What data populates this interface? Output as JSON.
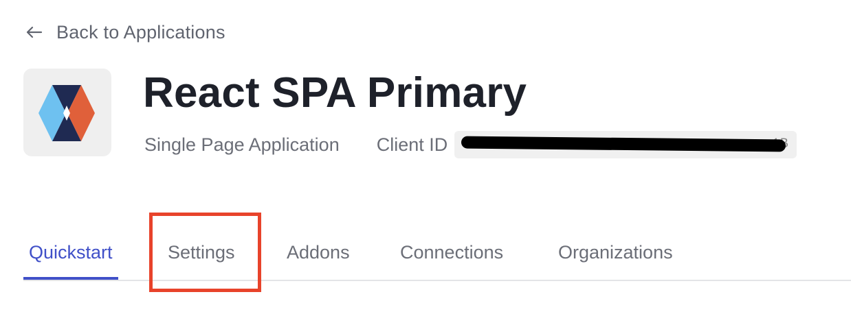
{
  "back_link": {
    "label": "Back to Applications",
    "icon": "arrow-left-icon"
  },
  "app": {
    "title": "React SPA Primary",
    "type": "Single Page Application",
    "client_id_label": "Client ID",
    "client_id_value": "[redacted]",
    "client_id_tail": "1B",
    "logo_icon": "spa-logo-icon"
  },
  "tabs": [
    {
      "label": "Quickstart",
      "active": true
    },
    {
      "label": "Settings",
      "active": false
    },
    {
      "label": "Addons",
      "active": false
    },
    {
      "label": "Connections",
      "active": false
    },
    {
      "label": "Organizations",
      "active": false
    }
  ],
  "annotation": {
    "highlighted_tab": "Settings",
    "color": "#e8432b"
  },
  "colors": {
    "accent": "#4050c8",
    "text_primary": "#1e212a",
    "text_secondary": "#6b6e77",
    "logo_light_blue": "#6ec1f0",
    "logo_navy": "#1f2a52",
    "logo_orange": "#e0603a"
  }
}
